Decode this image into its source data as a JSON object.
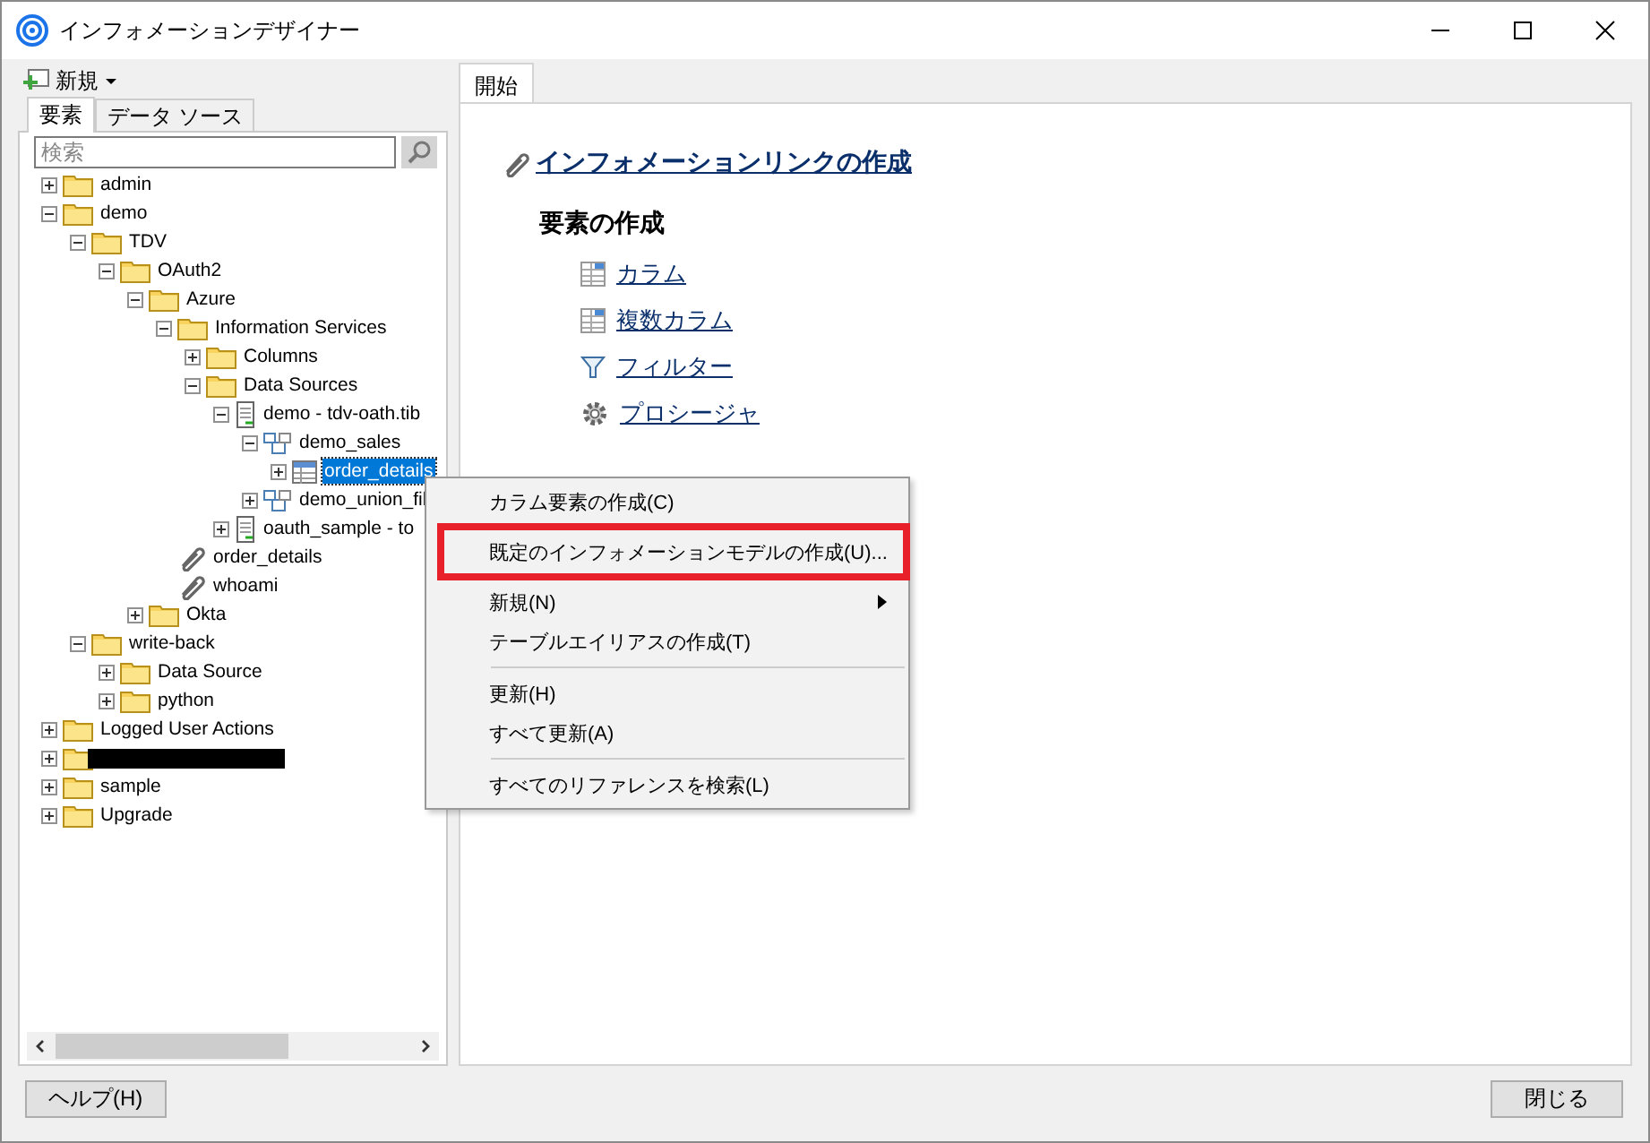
{
  "window": {
    "title": "インフォメーションデザイナー"
  },
  "toolbar": {
    "new_button": "新規"
  },
  "left_tabs": [
    {
      "label": "要素",
      "selected": true
    },
    {
      "label": "データ ソース",
      "selected": false
    }
  ],
  "search": {
    "placeholder": "検索"
  },
  "tree": [
    {
      "kind": "folder",
      "label": "admin",
      "expanded": false,
      "selected": false
    },
    {
      "kind": "folder",
      "label": "demo",
      "expanded": true,
      "selected": false,
      "children": [
        {
          "kind": "folder",
          "label": "TDV",
          "expanded": true,
          "selected": false,
          "children": [
            {
              "kind": "folder",
              "label": "OAuth2",
              "expanded": true,
              "selected": false,
              "children": [
                {
                  "kind": "folder",
                  "label": "Azure",
                  "expanded": true,
                  "selected": false,
                  "children": [
                    {
                      "kind": "folder",
                      "label": "Information Services",
                      "expanded": true,
                      "selected": false,
                      "children": [
                        {
                          "kind": "folder",
                          "label": "Columns",
                          "expanded": false,
                          "selected": false
                        },
                        {
                          "kind": "folder",
                          "label": "Data Sources",
                          "expanded": true,
                          "selected": false,
                          "children": [
                            {
                              "kind": "datasource",
                              "label": "demo - tdv-oath.tib",
                              "expanded": true,
                              "selected": false,
                              "children": [
                                {
                                  "kind": "schema",
                                  "label": "demo_sales",
                                  "expanded": true,
                                  "selected": false,
                                  "children": [
                                    {
                                      "kind": "table",
                                      "label": "order_details",
                                      "expanded": false,
                                      "selected": true
                                    }
                                  ]
                                },
                                {
                                  "kind": "schema",
                                  "label": "demo_union_fil",
                                  "expanded": false,
                                  "selected": false
                                }
                              ]
                            },
                            {
                              "kind": "datasource",
                              "label": "oauth_sample - to",
                              "expanded": false,
                              "selected": false
                            }
                          ]
                        }
                      ]
                    },
                    {
                      "kind": "link",
                      "label": "order_details",
                      "selected": false
                    },
                    {
                      "kind": "link",
                      "label": "whoami",
                      "selected": false
                    }
                  ]
                },
                {
                  "kind": "folder",
                  "label": "Okta",
                  "expanded": false,
                  "selected": false
                }
              ]
            }
          ]
        },
        {
          "kind": "folder",
          "label": "write-back",
          "expanded": true,
          "selected": false,
          "children": [
            {
              "kind": "folder",
              "label": "Data Source",
              "expanded": false,
              "selected": false
            },
            {
              "kind": "folder",
              "label": "python",
              "expanded": false,
              "selected": false
            }
          ]
        }
      ]
    },
    {
      "kind": "folder",
      "label": "Logged User Actions",
      "expanded": false,
      "selected": false
    },
    {
      "kind": "redacted",
      "expanded": false,
      "selected": false
    },
    {
      "kind": "folder",
      "label": "sample",
      "expanded": false,
      "selected": false
    },
    {
      "kind": "folder",
      "label": "Upgrade",
      "expanded": false,
      "selected": false
    }
  ],
  "main_tabs": [
    {
      "label": "開始",
      "selected": true
    }
  ],
  "start_page": {
    "create_link": "インフォメーションリンクの作成",
    "section_title": "要素の作成",
    "items": [
      {
        "kind": "column",
        "label": "カラム"
      },
      {
        "kind": "column",
        "label": "複数カラム"
      },
      {
        "kind": "filter",
        "label": "フィルター"
      },
      {
        "kind": "procedure",
        "label": "プロシージャ"
      }
    ]
  },
  "context_menu": [
    {
      "kind": "item",
      "label": "カラム要素の作成(C)",
      "highlighted": false,
      "submenu": false
    },
    {
      "kind": "item",
      "label": "既定のインフォメーションモデルの作成(U)...",
      "highlighted": true,
      "submenu": false
    },
    {
      "kind": "item",
      "label": "新規(N)",
      "highlighted": false,
      "submenu": true
    },
    {
      "kind": "item",
      "label": "テーブルエイリアスの作成(T)",
      "highlighted": false,
      "submenu": false
    },
    {
      "kind": "separator"
    },
    {
      "kind": "item",
      "label": "更新(H)",
      "highlighted": false,
      "submenu": false
    },
    {
      "kind": "item",
      "label": "すべて更新(A)",
      "highlighted": false,
      "submenu": false
    },
    {
      "kind": "separator"
    },
    {
      "kind": "item",
      "label": "すべてのリファレンスを検索(L)",
      "highlighted": false,
      "submenu": false
    }
  ],
  "buttons": {
    "help": "ヘルプ(H)",
    "close": "閉じる"
  }
}
